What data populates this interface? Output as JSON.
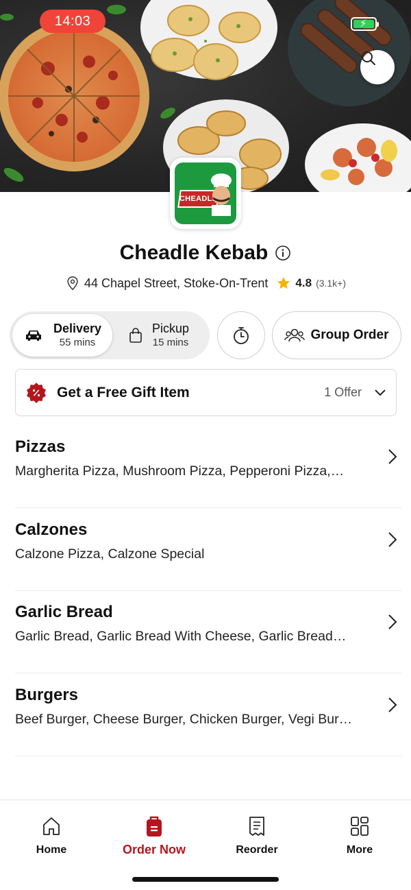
{
  "status_bar": {
    "time": "14:03"
  },
  "restaurant": {
    "name": "Cheadle Kebab",
    "logo_text": "CHEADLE",
    "address": "44 Chapel Street, Stoke-On-Trent",
    "rating": "4.8",
    "rating_count": "(3.1k+)"
  },
  "order_mode": {
    "delivery": {
      "label": "Delivery",
      "time": "55 mins"
    },
    "pickup": {
      "label": "Pickup",
      "time": "15 mins"
    },
    "group_order_label": "Group Order"
  },
  "offer": {
    "title": "Get a Free Gift Item",
    "count": "1 Offer"
  },
  "categories": [
    {
      "name": "Pizzas",
      "items": "Margherita Pizza, Mushroom Pizza, Pepperoni Pizza,…"
    },
    {
      "name": "Calzones",
      "items": "Calzone Pizza, Calzone Special"
    },
    {
      "name": "Garlic Bread",
      "items": "Garlic Bread, Garlic Bread With Cheese, Garlic Bread…"
    },
    {
      "name": "Burgers",
      "items": "Beef Burger, Cheese Burger, Chicken Burger, Vegi Bur…"
    }
  ],
  "bottom_nav": [
    {
      "label": "Home",
      "icon": "home-icon"
    },
    {
      "label": "Order Now",
      "icon": "order-bag-icon",
      "active": true
    },
    {
      "label": "Reorder",
      "icon": "receipt-icon"
    },
    {
      "label": "More",
      "icon": "grid-icon"
    }
  ],
  "colors": {
    "accent": "#b3171d",
    "status_time_bg": "#f04438",
    "star": "#f5b301",
    "logo_green": "#1e9a3e",
    "battery": "#30d158"
  }
}
